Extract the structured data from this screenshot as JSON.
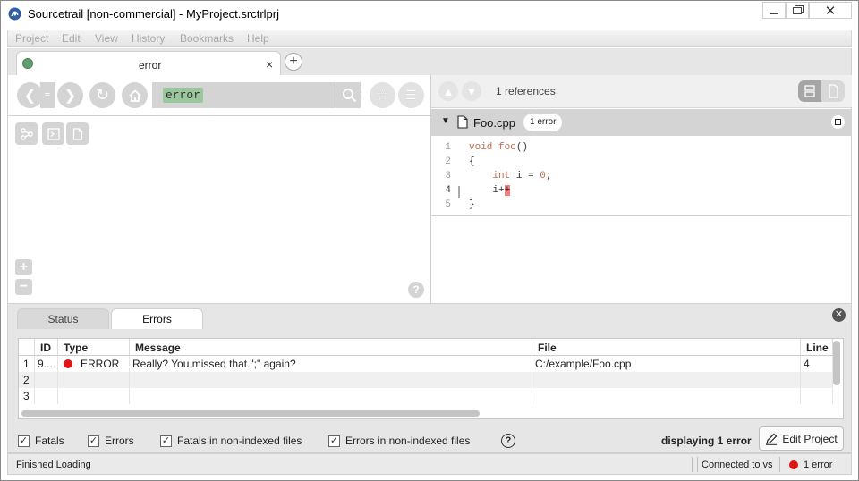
{
  "window": {
    "title": "Sourcetrail [non-commercial] - MyProject.srctrlprj"
  },
  "menu": [
    "Project",
    "Edit",
    "View",
    "History",
    "Bookmarks",
    "Help"
  ],
  "tab": {
    "label": "error",
    "close": "×",
    "add": "+"
  },
  "search": {
    "query": "error"
  },
  "references": {
    "count_label": "1 references"
  },
  "file": {
    "name": "Foo.cpp",
    "badge": "1 error"
  },
  "code": {
    "lines": [
      {
        "n": "1",
        "text": "void foo()"
      },
      {
        "n": "2",
        "text": "{"
      },
      {
        "n": "3",
        "text": "    int i = 0;"
      },
      {
        "n": "4",
        "text": "    i++"
      },
      {
        "n": "5",
        "text": "}"
      }
    ]
  },
  "bottom_tabs": {
    "status": "Status",
    "errors": "Errors"
  },
  "errors_table": {
    "headers": {
      "id": "ID",
      "type": "Type",
      "message": "Message",
      "file": "File",
      "line": "Line"
    },
    "rows": [
      {
        "num": "1",
        "id": "9...",
        "type": "ERROR",
        "message": "Really? You missed that \";\" again?",
        "file": "C:/example/Foo.cpp",
        "line": "4"
      },
      {
        "num": "2",
        "id": "",
        "type": "",
        "message": "",
        "file": "",
        "line": ""
      },
      {
        "num": "3",
        "id": "",
        "type": "",
        "message": "",
        "file": "",
        "line": ""
      }
    ]
  },
  "filters": {
    "fatals": "Fatals",
    "errors": "Errors",
    "fatals_nonindexed": "Fatals in non-indexed files",
    "errors_nonindexed": "Errors in non-indexed files"
  },
  "help": "?",
  "display_count": "displaying 1 error",
  "edit_project": "Edit Project",
  "status": {
    "left": "Finished Loading",
    "connection": "Connected to vs",
    "errors": "1 error"
  },
  "colors": {
    "error_red": "#e01515",
    "search_highlight": "#9bc79c",
    "keyword": "#c06a4c",
    "file_dot": "#5f9e6e"
  }
}
